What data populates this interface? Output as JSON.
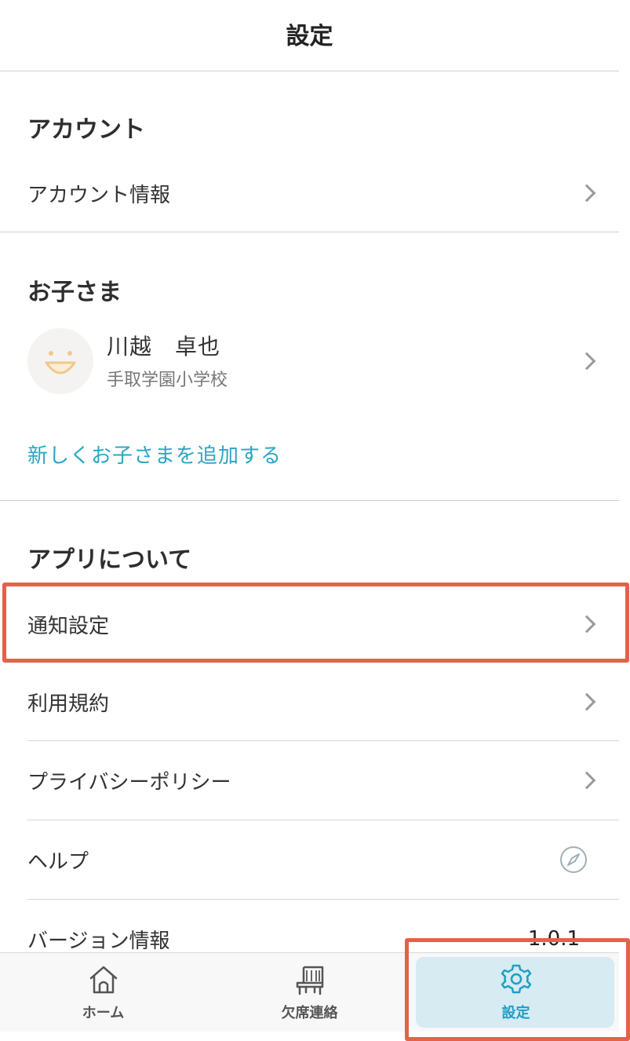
{
  "header": {
    "title": "設定"
  },
  "account": {
    "section_title": "アカウント",
    "info_label": "アカウント情報"
  },
  "children": {
    "section_title": "お子さま",
    "child": {
      "name": "川越　卓也",
      "school": "手取学園小学校"
    },
    "add_link": "新しくお子さまを追加する"
  },
  "app": {
    "section_title": "アプリについて",
    "items": [
      {
        "label": "通知設定"
      },
      {
        "label": "利用規約"
      },
      {
        "label": "プライバシーポリシー"
      },
      {
        "label": "ヘルプ",
        "icon": "compass-icon"
      },
      {
        "label": "バージョン情報",
        "value": "1.0.1"
      }
    ]
  },
  "tabbar": {
    "tabs": [
      {
        "label": "ホーム",
        "icon": "home-icon"
      },
      {
        "label": "欠席連絡",
        "icon": "chair-icon"
      },
      {
        "label": "設定",
        "icon": "gear-icon",
        "active": true
      }
    ]
  },
  "colors": {
    "accent": "#2aa6c4",
    "highlight": "#e4614a",
    "active_tab_bg": "#d6ebf2"
  }
}
